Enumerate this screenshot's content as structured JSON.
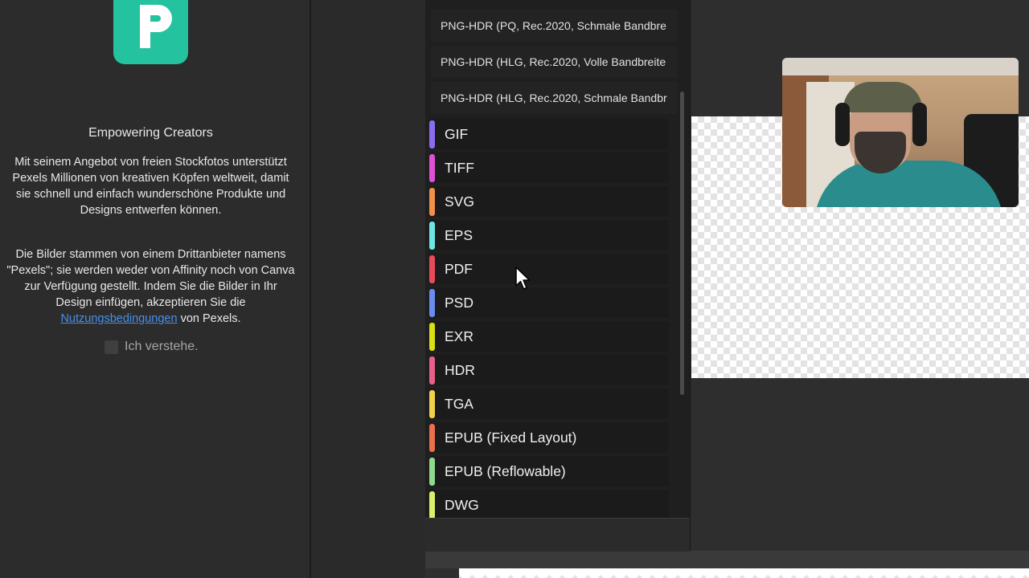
{
  "left_panel": {
    "title": "Empowering Creators",
    "paragraph1": "Mit seinem Angebot von freien Stockfotos unterstützt Pexels Millionen von kreativen Köpfen weltweit, damit sie schnell und einfach wunderschöne Produkte und Designs entwerfen können.",
    "paragraph2_start": "Die Bilder stammen von einem Drittanbieter namens \"Pexels\"; sie werden weder von Affinity noch von Canva zur Verfügung gestellt. Indem Sie die Bilder in Ihr Design einfügen, akzeptieren Sie die ",
    "paragraph2_link": "Nutzungsbedingungen",
    "paragraph2_end": " von Pexels.",
    "consent_label": "Ich verstehe.",
    "logo_color": "#25c2a0"
  },
  "dropdown": {
    "hdr_items": [
      "PNG-HDR (PQ, Rec.2020, Schmale Bandbre",
      "PNG-HDR (HLG, Rec.2020, Volle Bandbreite",
      "PNG-HDR (HLG, Rec.2020, Schmale Bandbr"
    ],
    "formats": [
      {
        "label": "GIF",
        "color": "#8a6cf0"
      },
      {
        "label": "TIFF",
        "color": "#e04fd6"
      },
      {
        "label": "SVG",
        "color": "#f0904a"
      },
      {
        "label": "EPS",
        "color": "#6ee6e0"
      },
      {
        "label": "PDF",
        "color": "#e84a5a"
      },
      {
        "label": "PSD",
        "color": "#6a8cf0"
      },
      {
        "label": "EXR",
        "color": "#d8e010"
      },
      {
        "label": "HDR",
        "color": "#e8608a"
      },
      {
        "label": "TGA",
        "color": "#f0d24a"
      },
      {
        "label": "EPUB (Fixed Layout)",
        "color": "#e8704a"
      },
      {
        "label": "EPUB (Reflowable)",
        "color": "#8ed890"
      },
      {
        "label": "DWG",
        "color": "#d8f06a"
      }
    ]
  }
}
